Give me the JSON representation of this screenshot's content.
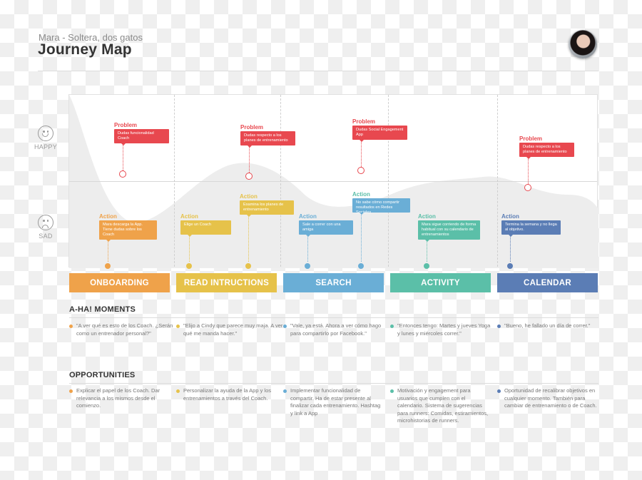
{
  "header": {
    "persona": "Mara - Soltera, dos gatos",
    "title": "Journey Map",
    "avatar_icon": "persona-photo"
  },
  "moods": {
    "happy": {
      "label": "HAPPY",
      "icon": "smiley-face-icon"
    },
    "sad": {
      "label": "SAD",
      "icon": "sad-face-icon"
    }
  },
  "colors": {
    "problem": "#e8484f",
    "onboarding": "#efa24a",
    "read": "#e6c24a",
    "search": "#6aaed6",
    "activity": "#5bbfa8",
    "calendar": "#5b7db5",
    "curve": "#ededed"
  },
  "problems": [
    {
      "kind": "Problem",
      "text": "Dudas funcionalidad Coach"
    },
    {
      "kind": "Problem",
      "text": "Dudas respecto a los planes de entrenamiento"
    },
    {
      "kind": "Problem",
      "text": "Dudas Social Engagement App"
    },
    {
      "kind": "Problem",
      "text": "Dudas respecto a los planes de entrenamiento"
    }
  ],
  "actions": [
    {
      "kind": "Action",
      "text": "Mara descarga la App. Tiene dudas sobre los Coach",
      "stage": "onboarding"
    },
    {
      "kind": "Action",
      "text": "Elige un Coach",
      "stage": "read"
    },
    {
      "kind": "Action",
      "text": "Examina los planes de entrenamiento",
      "stage": "read"
    },
    {
      "kind": "Action",
      "text": "Sale a correr con una amiga",
      "stage": "search"
    },
    {
      "kind": "Action",
      "text": "No sabe cómo compartir resultados en Redes Sociales",
      "stage": "search"
    },
    {
      "kind": "Action",
      "text": "Mara sigue corriendo de forma habitual con su calendario de entrenamientos",
      "stage": "activity"
    },
    {
      "kind": "Action",
      "text": "Termina la semana y no llega al objetivo.",
      "stage": "calendar"
    }
  ],
  "stages": [
    {
      "label": "ONBOARDING",
      "key": "onboarding"
    },
    {
      "label": "READ INTRUCTIONS",
      "key": "read"
    },
    {
      "label": "SEARCH",
      "key": "search"
    },
    {
      "label": "ACTIVITY",
      "key": "activity"
    },
    {
      "label": "CALENDAR",
      "key": "calendar"
    }
  ],
  "aha": {
    "title": "A-HA! MOMENTS",
    "items": [
      "\"A ver qué es esto de los Coach. ¿Serán como un entrenador personal?\"",
      "\"Elijo a Cindy que parece muy maja. A ver qué me manda hacer.\"",
      "\"Vale, ya está. Ahora a ver cómo hago para compartirlo por Facebook.\"",
      "\"Entonces tengo: Martes y jueves Yoga y lunes y miércoles correr.\"",
      "\"Bueno, he fallado un día de correr.\""
    ]
  },
  "opportunities": {
    "title": "OPPORTUNITIES",
    "items": [
      "Explicar el papel de los Coach. Dar relevancia a los mismos desde el comienzo.",
      "Personalizar la ayuda de la App y los entrenamientos a través del Coach.",
      "Implementar funcionalidad de compartir. Ha de estar presente al finalizar cada entrenamiento. Hashtag y link a App",
      "Motivación y engagement para usuarios que cumplen con el calendario. Sistema de sugerencias para runners: Comidas, estiramientos, microhistorias de runners.",
      "Oportunidad de recalibrar objetivos en cualquier momento. También para cambiar de entrenamiento o de Coach."
    ]
  }
}
